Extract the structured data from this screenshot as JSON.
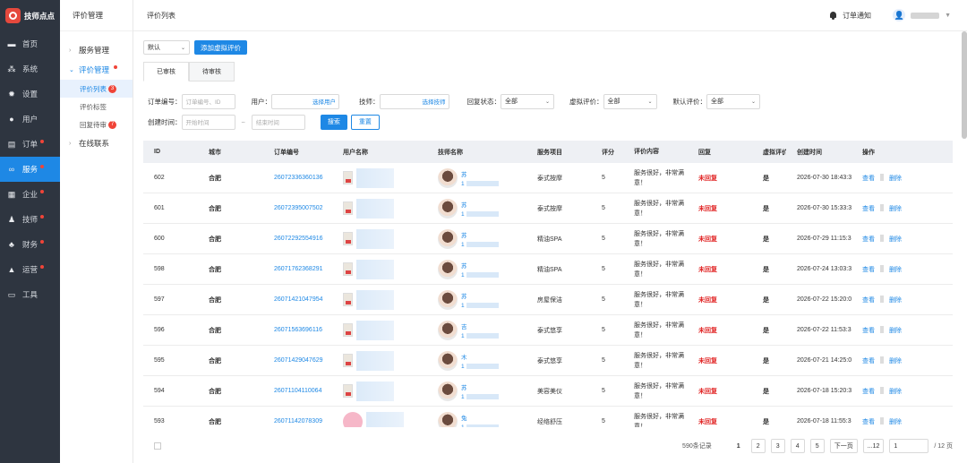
{
  "app": {
    "name": "技师点点"
  },
  "nav": [
    {
      "label": "首页",
      "icon": "monitor-icon",
      "dot": false,
      "active": false
    },
    {
      "label": "系统",
      "icon": "sitemap-icon",
      "dot": false,
      "active": false
    },
    {
      "label": "设置",
      "icon": "gear-icon",
      "dot": false,
      "active": false
    },
    {
      "label": "用户",
      "icon": "user-icon",
      "dot": false,
      "active": false
    },
    {
      "label": "订单",
      "icon": "clipboard-icon",
      "dot": true,
      "active": false
    },
    {
      "label": "服务",
      "icon": "link-icon",
      "dot": true,
      "active": true
    },
    {
      "label": "企业",
      "icon": "building-icon",
      "dot": true,
      "active": false
    },
    {
      "label": "技师",
      "icon": "person-icon",
      "dot": true,
      "active": false
    },
    {
      "label": "财务",
      "icon": "finance-icon",
      "dot": true,
      "active": false
    },
    {
      "label": "运营",
      "icon": "chart-icon",
      "dot": true,
      "active": false
    },
    {
      "label": "工具",
      "icon": "toolbox-icon",
      "dot": false,
      "active": false
    }
  ],
  "subnav": {
    "title": "评价管理",
    "group1": "服务管理",
    "group2": "评价管理",
    "item1": "评价列表",
    "item1_badge": "3",
    "item2": "评价标签",
    "item3": "回复待审",
    "item3_badge": "7",
    "group3": "在线联系"
  },
  "header": {
    "title": "评价列表",
    "notify": "订单通知"
  },
  "toolbar": {
    "sort_value": "默认",
    "add_button": "添加虚拟评价"
  },
  "tabs": {
    "reviewed": "已审核",
    "pending": "待审核"
  },
  "filters": {
    "order_label": "订单编号：",
    "order_placeholder": "订单编号、ID",
    "user_label": "用户：",
    "user_link": "选择用户",
    "tech_label": "技师：",
    "tech_link": "选择技师",
    "reply_label": "回复状态：",
    "reply_value": "全部",
    "virtual_label": "虚拟评价：",
    "virtual_value": "全部",
    "default_label": "默认评价：",
    "default_value": "全部",
    "time_label": "创建时间：",
    "start_placeholder": "开始时间",
    "sep": "~",
    "end_placeholder": "结束时间",
    "search_button": "搜索",
    "reset_button": "重置"
  },
  "table": {
    "headers": {
      "id": "ID",
      "city": "城市",
      "order": "订单编号",
      "user": "用户名称",
      "tech": "技师名称",
      "service": "服务项目",
      "score": "评分",
      "content": "评价内容",
      "reply": "回复",
      "virtual": "虚拟评价",
      "time": "创建时间",
      "op": "操作"
    },
    "rows": [
      {
        "id": "602",
        "city": "合肥",
        "order": "26072336360136",
        "tech_initial": "苏",
        "tech_prefix": "1",
        "service": "泰式按摩",
        "score": "5",
        "content": "服务很好，非常满意！",
        "reply": "未回复",
        "virtual": "是",
        "time": "2026-07-30 18:43:34",
        "view": "查看",
        "del": "删除"
      },
      {
        "id": "601",
        "city": "合肥",
        "order": "26072395007502",
        "tech_initial": "苏",
        "tech_prefix": "1",
        "service": "泰式按摩",
        "score": "5",
        "content": "服务很好，非常满意！",
        "reply": "未回复",
        "virtual": "是",
        "time": "2026-07-30 15:33:35",
        "view": "查看",
        "del": "删除"
      },
      {
        "id": "600",
        "city": "合肥",
        "order": "26072292554916",
        "tech_initial": "苏",
        "tech_prefix": "1",
        "service": "精油SPA",
        "score": "5",
        "content": "服务很好，非常满意！",
        "reply": "未回复",
        "virtual": "是",
        "time": "2026-07-29 11:15:33",
        "view": "查看",
        "del": "删除"
      },
      {
        "id": "598",
        "city": "合肥",
        "order": "26071762368291",
        "tech_initial": "苏",
        "tech_prefix": "1",
        "service": "精油SPA",
        "score": "5",
        "content": "服务很好，非常满意！",
        "reply": "未回复",
        "virtual": "是",
        "time": "2026-07-24 13:03:34",
        "view": "查看",
        "del": "删除"
      },
      {
        "id": "597",
        "city": "合肥",
        "order": "26071421047954",
        "tech_initial": "苏",
        "tech_prefix": "1",
        "service": "房屋保洁",
        "score": "5",
        "content": "服务很好，非常满意！",
        "reply": "未回复",
        "virtual": "是",
        "time": "2026-07-22 15:20:06",
        "view": "查看",
        "del": "删除"
      },
      {
        "id": "596",
        "city": "合肥",
        "order": "26071563696116",
        "tech_initial": "吉",
        "tech_prefix": "1",
        "service": "泰式悠享",
        "score": "5",
        "content": "服务很好，非常满意！",
        "reply": "未回复",
        "virtual": "是",
        "time": "2026-07-22 11:53:33",
        "view": "查看",
        "del": "删除"
      },
      {
        "id": "595",
        "city": "合肥",
        "order": "26071429047629",
        "tech_initial": "木",
        "tech_prefix": "1",
        "service": "泰式悠享",
        "score": "5",
        "content": "服务很好，非常满意！",
        "reply": "未回复",
        "virtual": "是",
        "time": "2026-07-21 14:25:04",
        "view": "查看",
        "del": "删除"
      },
      {
        "id": "594",
        "city": "合肥",
        "order": "26071104110064",
        "tech_initial": "苏",
        "tech_prefix": "1",
        "service": "美容美仪",
        "score": "5",
        "content": "服务很好，非常满意！",
        "reply": "未回复",
        "virtual": "是",
        "time": "2026-07-18 15:20:34",
        "view": "查看",
        "del": "删除"
      },
      {
        "id": "593",
        "city": "合肥",
        "order": "26071142078309",
        "tech_initial": "兔",
        "tech_prefix": "1",
        "service": "经络舒压",
        "score": "5",
        "content": "服务很好，非常满意！",
        "reply": "未回复",
        "virtual": "是",
        "time": "2026-07-18 11:55:33",
        "view": "查看",
        "del": "删除"
      }
    ]
  },
  "pagination": {
    "total": "590条记录",
    "pages": [
      "1",
      "2",
      "3",
      "4",
      "5"
    ],
    "next": "下一页",
    "ellipsis": "...",
    "last": "12",
    "jump_value": "1",
    "total_pages": "/ 12 页"
  }
}
